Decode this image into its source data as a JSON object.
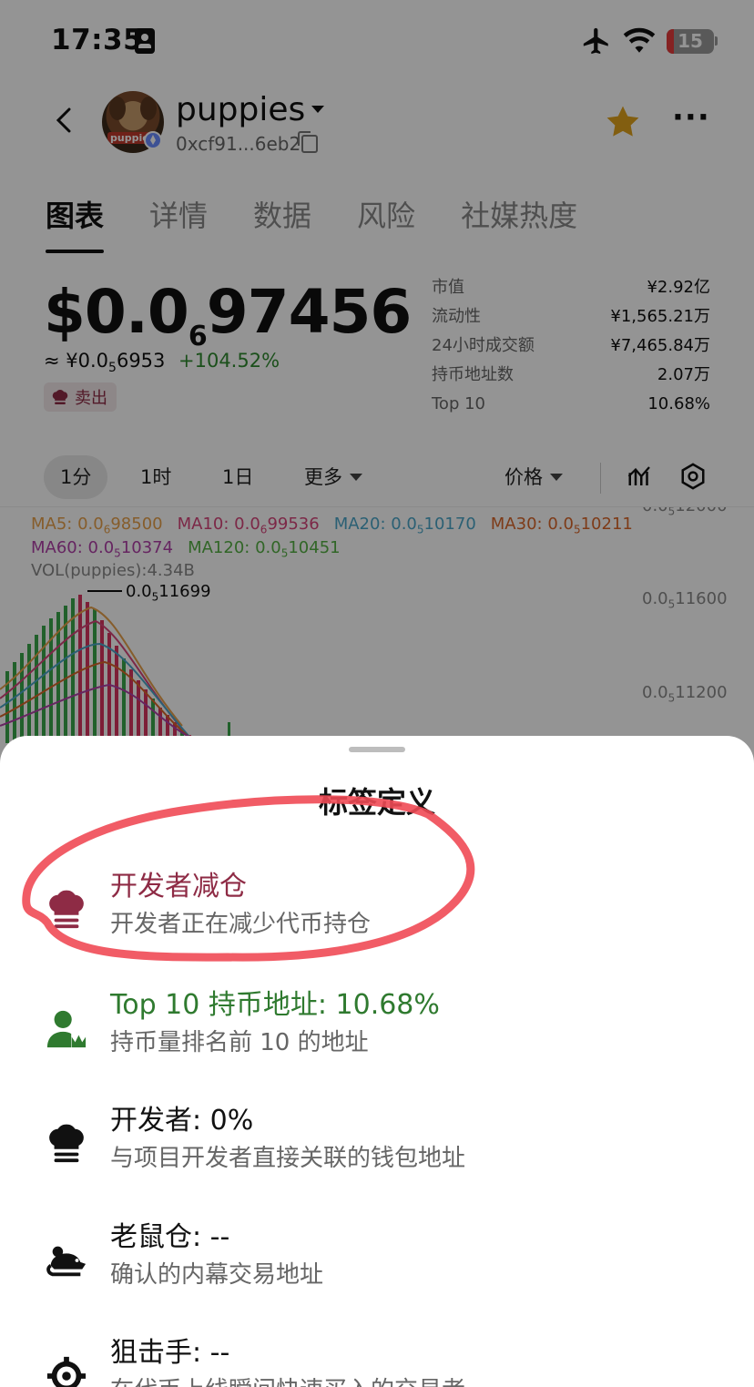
{
  "status_bar": {
    "time": "17:35",
    "battery": "15"
  },
  "header": {
    "token_name": "puppies",
    "token_address": "0xcf91...6eb2",
    "avatar_text": "puppie"
  },
  "tabs": [
    "图表",
    "详情",
    "数据",
    "风险",
    "社媒热度"
  ],
  "price": {
    "main_prefix": "$0.0",
    "main_sub": "6",
    "main_suffix": "97456",
    "cny_prefix": "≈ ¥0.0",
    "cny_sub": "5",
    "cny_suffix": "6953",
    "change": "+104.52%",
    "tag": "卖出"
  },
  "stats": [
    {
      "label": "市值",
      "value": "¥2.92亿"
    },
    {
      "label": "流动性",
      "value": "¥1,565.21万"
    },
    {
      "label": "24小时成交额",
      "value": "¥7,465.84万"
    },
    {
      "label": "持币地址数",
      "value": "2.07万"
    },
    {
      "label": "Top 10",
      "value": "10.68%"
    }
  ],
  "intervals": {
    "i1": "1分",
    "i2": "1时",
    "i3": "1日",
    "more": "更多",
    "price": "价格"
  },
  "chart": {
    "ma": [
      {
        "label": "MA5: 0.0",
        "sub": "6",
        "rest": "98500",
        "color": "#e7a04a"
      },
      {
        "label": "MA10: 0.0",
        "sub": "6",
        "rest": "99536",
        "color": "#d6457a"
      },
      {
        "label": "MA20: 0.0",
        "sub": "5",
        "rest": "10170",
        "color": "#4aa6c9"
      },
      {
        "label": "MA30: 0.0",
        "sub": "5",
        "rest": "10211",
        "color": "#d9672a"
      },
      {
        "label": "MA60: 0.0",
        "sub": "5",
        "rest": "10374",
        "color": "#b040a8"
      },
      {
        "label": "MA120: 0.0",
        "sub": "5",
        "rest": "10451",
        "color": "#55b044"
      }
    ],
    "vol": "VOL(puppies):4.34B",
    "peak": {
      "prefix": "0.0",
      "sub": "5",
      "rest": "11699"
    },
    "axis": [
      {
        "prefix": "0.0",
        "sub": "5",
        "rest": "12000"
      },
      {
        "prefix": "0.0",
        "sub": "5",
        "rest": "11600"
      },
      {
        "prefix": "0.0",
        "sub": "5",
        "rest": "11200"
      }
    ],
    "colors": {
      "up": "#3aa64a",
      "down": "#d8345f"
    }
  },
  "sheet": {
    "title": "标签定义",
    "items": [
      {
        "title": "开发者减仓",
        "desc": "开发者正在减少代币持仓",
        "icon": "chef-hat-icon",
        "color": "#8e2b45"
      },
      {
        "title": "Top 10 持币地址: 10.68%",
        "desc": "持币量排名前 10 的地址",
        "icon": "top-holder-icon",
        "color": "#2f7a2f"
      },
      {
        "title": "开发者: 0%",
        "desc": "与项目开发者直接关联的钱包地址",
        "icon": "chef-hat-icon",
        "color": "#111111"
      },
      {
        "title": "老鼠仓: --",
        "desc": "确认的内幕交易地址",
        "icon": "rat-icon",
        "color": "#111111"
      },
      {
        "title": "狙击手: --",
        "desc": "在代币上线瞬间快速买入的交易者",
        "icon": "crosshair-icon",
        "color": "#111111"
      }
    ]
  },
  "colors": {
    "accent_star": "#e0a21d",
    "positive": "#2f8a2f",
    "dev_sell": "#8e2b45",
    "annotation": "#ef4a55"
  }
}
